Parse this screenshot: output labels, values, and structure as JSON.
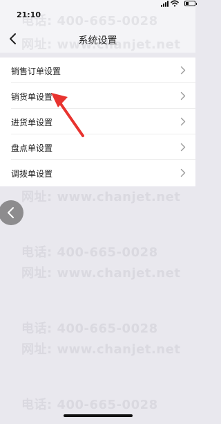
{
  "status_bar": {
    "time": "21:10"
  },
  "navbar": {
    "title": "系统设置"
  },
  "settings": {
    "items": [
      {
        "label": "销售订单设置"
      },
      {
        "label": "销货单设置"
      },
      {
        "label": "进货单设置"
      },
      {
        "label": "盘点单设置"
      },
      {
        "label": "调拨单设置"
      }
    ]
  },
  "watermark": {
    "phone": "电话: 400-665-0028",
    "site": "网址: www.chanjet.net"
  },
  "colors": {
    "background": "#e9e8ee",
    "list_bg": "#ffffff",
    "annotation_arrow": "#e8332f"
  }
}
